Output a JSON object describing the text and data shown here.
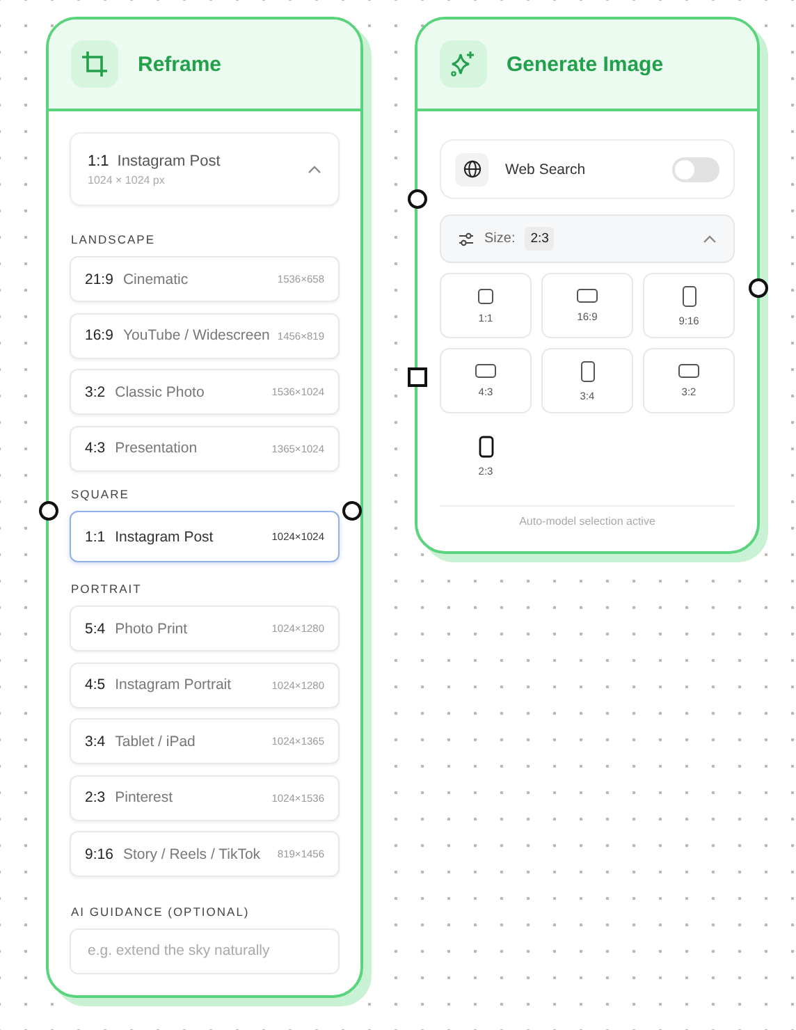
{
  "reframe": {
    "title": "Reframe",
    "current": {
      "ratio": "1:1",
      "name": "Instagram Post",
      "size": "1024 × 1024 px",
      "expanded": true
    },
    "groups": [
      {
        "label": "LANDSCAPE",
        "options": [
          {
            "ratio": "21:9",
            "name": "Cinematic",
            "size": "1536×658",
            "selected": false
          },
          {
            "ratio": "16:9",
            "name": "YouTube / Widescreen",
            "size": "1456×819",
            "selected": false
          },
          {
            "ratio": "3:2",
            "name": "Classic Photo",
            "size": "1536×1024",
            "selected": false
          },
          {
            "ratio": "4:3",
            "name": "Presentation",
            "size": "1365×1024",
            "selected": false
          }
        ]
      },
      {
        "label": "SQUARE",
        "options": [
          {
            "ratio": "1:1",
            "name": "Instagram Post",
            "size": "1024×1024",
            "selected": true
          }
        ]
      },
      {
        "label": "PORTRAIT",
        "options": [
          {
            "ratio": "5:4",
            "name": "Photo Print",
            "size": "1024×1280",
            "selected": false
          },
          {
            "ratio": "4:5",
            "name": "Instagram Portrait",
            "size": "1024×1280",
            "selected": false
          },
          {
            "ratio": "3:4",
            "name": "Tablet / iPad",
            "size": "1024×1365",
            "selected": false
          },
          {
            "ratio": "2:3",
            "name": "Pinterest",
            "size": "1024×1536",
            "selected": false
          },
          {
            "ratio": "9:16",
            "name": "Story / Reels / TikTok",
            "size": "819×1456",
            "selected": false
          }
        ]
      }
    ],
    "guidance": {
      "label": "AI GUIDANCE (OPTIONAL)",
      "placeholder": "e.g. extend the sky naturally"
    }
  },
  "generate": {
    "title": "Generate Image",
    "web_search": {
      "label": "Web Search",
      "on": false
    },
    "size": {
      "label": "Size:",
      "value": "2:3",
      "expanded": true
    },
    "sizes": [
      {
        "label": "1:1",
        "kind": "square",
        "selected": false
      },
      {
        "label": "16:9",
        "kind": "wide",
        "selected": false
      },
      {
        "label": "9:16",
        "kind": "tall",
        "selected": false
      },
      {
        "label": "4:3",
        "kind": "wide",
        "selected": false
      },
      {
        "label": "3:4",
        "kind": "tall",
        "selected": false
      },
      {
        "label": "3:2",
        "kind": "wide",
        "selected": false
      },
      {
        "label": "2:3",
        "kind": "tall",
        "selected": true
      }
    ],
    "footer": "Auto-model selection active"
  }
}
